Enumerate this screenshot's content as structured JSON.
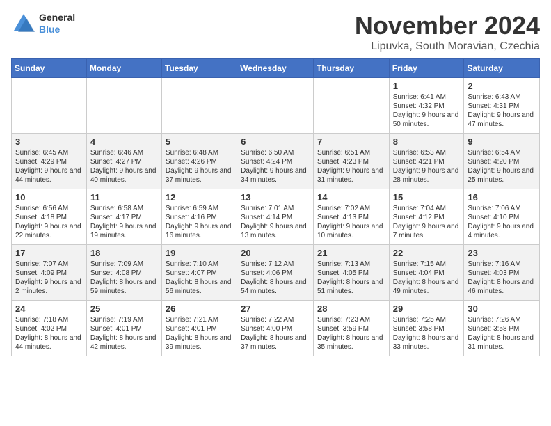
{
  "logo": {
    "line1": "General",
    "line2": "Blue"
  },
  "title": "November 2024",
  "location": "Lipuvka, South Moravian, Czechia",
  "days_of_week": [
    "Sunday",
    "Monday",
    "Tuesday",
    "Wednesday",
    "Thursday",
    "Friday",
    "Saturday"
  ],
  "weeks": [
    [
      {
        "day": "",
        "content": ""
      },
      {
        "day": "",
        "content": ""
      },
      {
        "day": "",
        "content": ""
      },
      {
        "day": "",
        "content": ""
      },
      {
        "day": "",
        "content": ""
      },
      {
        "day": "1",
        "content": "Sunrise: 6:41 AM\nSunset: 4:32 PM\nDaylight: 9 hours and 50 minutes."
      },
      {
        "day": "2",
        "content": "Sunrise: 6:43 AM\nSunset: 4:31 PM\nDaylight: 9 hours and 47 minutes."
      }
    ],
    [
      {
        "day": "3",
        "content": "Sunrise: 6:45 AM\nSunset: 4:29 PM\nDaylight: 9 hours and 44 minutes."
      },
      {
        "day": "4",
        "content": "Sunrise: 6:46 AM\nSunset: 4:27 PM\nDaylight: 9 hours and 40 minutes."
      },
      {
        "day": "5",
        "content": "Sunrise: 6:48 AM\nSunset: 4:26 PM\nDaylight: 9 hours and 37 minutes."
      },
      {
        "day": "6",
        "content": "Sunrise: 6:50 AM\nSunset: 4:24 PM\nDaylight: 9 hours and 34 minutes."
      },
      {
        "day": "7",
        "content": "Sunrise: 6:51 AM\nSunset: 4:23 PM\nDaylight: 9 hours and 31 minutes."
      },
      {
        "day": "8",
        "content": "Sunrise: 6:53 AM\nSunset: 4:21 PM\nDaylight: 9 hours and 28 minutes."
      },
      {
        "day": "9",
        "content": "Sunrise: 6:54 AM\nSunset: 4:20 PM\nDaylight: 9 hours and 25 minutes."
      }
    ],
    [
      {
        "day": "10",
        "content": "Sunrise: 6:56 AM\nSunset: 4:18 PM\nDaylight: 9 hours and 22 minutes."
      },
      {
        "day": "11",
        "content": "Sunrise: 6:58 AM\nSunset: 4:17 PM\nDaylight: 9 hours and 19 minutes."
      },
      {
        "day": "12",
        "content": "Sunrise: 6:59 AM\nSunset: 4:16 PM\nDaylight: 9 hours and 16 minutes."
      },
      {
        "day": "13",
        "content": "Sunrise: 7:01 AM\nSunset: 4:14 PM\nDaylight: 9 hours and 13 minutes."
      },
      {
        "day": "14",
        "content": "Sunrise: 7:02 AM\nSunset: 4:13 PM\nDaylight: 9 hours and 10 minutes."
      },
      {
        "day": "15",
        "content": "Sunrise: 7:04 AM\nSunset: 4:12 PM\nDaylight: 9 hours and 7 minutes."
      },
      {
        "day": "16",
        "content": "Sunrise: 7:06 AM\nSunset: 4:10 PM\nDaylight: 9 hours and 4 minutes."
      }
    ],
    [
      {
        "day": "17",
        "content": "Sunrise: 7:07 AM\nSunset: 4:09 PM\nDaylight: 9 hours and 2 minutes."
      },
      {
        "day": "18",
        "content": "Sunrise: 7:09 AM\nSunset: 4:08 PM\nDaylight: 8 hours and 59 minutes."
      },
      {
        "day": "19",
        "content": "Sunrise: 7:10 AM\nSunset: 4:07 PM\nDaylight: 8 hours and 56 minutes."
      },
      {
        "day": "20",
        "content": "Sunrise: 7:12 AM\nSunset: 4:06 PM\nDaylight: 8 hours and 54 minutes."
      },
      {
        "day": "21",
        "content": "Sunrise: 7:13 AM\nSunset: 4:05 PM\nDaylight: 8 hours and 51 minutes."
      },
      {
        "day": "22",
        "content": "Sunrise: 7:15 AM\nSunset: 4:04 PM\nDaylight: 8 hours and 49 minutes."
      },
      {
        "day": "23",
        "content": "Sunrise: 7:16 AM\nSunset: 4:03 PM\nDaylight: 8 hours and 46 minutes."
      }
    ],
    [
      {
        "day": "24",
        "content": "Sunrise: 7:18 AM\nSunset: 4:02 PM\nDaylight: 8 hours and 44 minutes."
      },
      {
        "day": "25",
        "content": "Sunrise: 7:19 AM\nSunset: 4:01 PM\nDaylight: 8 hours and 42 minutes."
      },
      {
        "day": "26",
        "content": "Sunrise: 7:21 AM\nSunset: 4:01 PM\nDaylight: 8 hours and 39 minutes."
      },
      {
        "day": "27",
        "content": "Sunrise: 7:22 AM\nSunset: 4:00 PM\nDaylight: 8 hours and 37 minutes."
      },
      {
        "day": "28",
        "content": "Sunrise: 7:23 AM\nSunset: 3:59 PM\nDaylight: 8 hours and 35 minutes."
      },
      {
        "day": "29",
        "content": "Sunrise: 7:25 AM\nSunset: 3:58 PM\nDaylight: 8 hours and 33 minutes."
      },
      {
        "day": "30",
        "content": "Sunrise: 7:26 AM\nSunset: 3:58 PM\nDaylight: 8 hours and 31 minutes."
      }
    ]
  ]
}
